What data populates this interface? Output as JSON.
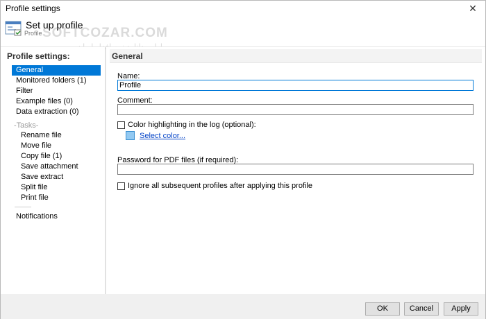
{
  "window": {
    "title": "Profile settings"
  },
  "header": {
    "title": "Set up profile",
    "subtitle": "Profile",
    "watermark": "SOFTCOZAR.COM",
    "watermark_sub": "اولین دانلود نرم افزار ایران"
  },
  "sidebar": {
    "header": "Profile settings:",
    "items": [
      {
        "label": "General",
        "selected": true
      },
      {
        "label": "Monitored folders (1)"
      },
      {
        "label": "Filter"
      },
      {
        "label": "Example files (0)"
      },
      {
        "label": "Data extraction (0)"
      }
    ],
    "tasks_header": "-Tasks-",
    "tasks": [
      {
        "label": "Rename file"
      },
      {
        "label": "Move file"
      },
      {
        "label": "Copy file (1)"
      },
      {
        "label": "Save attachment"
      },
      {
        "label": "Save extract"
      },
      {
        "label": "Split file"
      },
      {
        "label": "Print file"
      }
    ],
    "notifications": "Notifications"
  },
  "general": {
    "section_title": "General",
    "name_label": "Name:",
    "name_value": "Profile",
    "comment_label": "Comment:",
    "comment_value": "",
    "color_highlight_label": "Color highlighting in the log (optional):",
    "color_highlight_checked": false,
    "swatch_color": "#92c9f2",
    "select_color_label": "Select color...",
    "pdf_password_label": "Password for PDF files (if required):",
    "pdf_password_value": "",
    "ignore_label": "Ignore all subsequent profiles after applying this profile",
    "ignore_checked": false
  },
  "footer": {
    "ok_label": "OK",
    "cancel_label": "Cancel",
    "apply_label": "Apply"
  },
  "colors": {
    "accent": "#0078d7",
    "link": "#0645c8"
  }
}
